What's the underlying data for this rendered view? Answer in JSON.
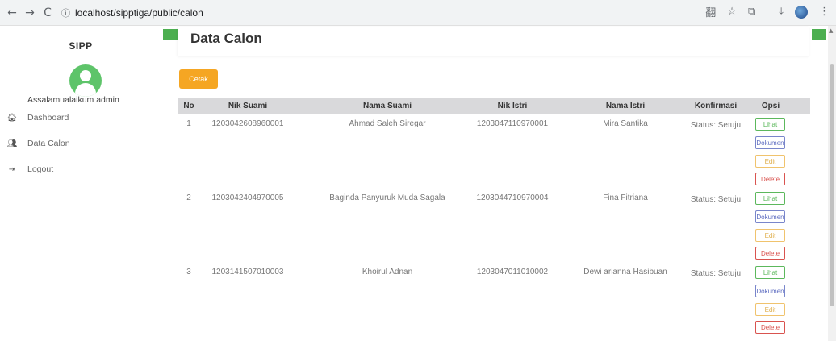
{
  "browser": {
    "url": "localhost/sipptiga/public/calon",
    "back_icon": "←",
    "forward_icon": "→",
    "reload_icon": "C",
    "info_icon": "ⓘ",
    "translate_icon": "翻",
    "star_icon": "☆",
    "extensions_icon": "⧉",
    "download_icon": "⤓",
    "menu_icon": "⋮"
  },
  "sidebar": {
    "brand": "SIPP",
    "greeting_prefix": "Assalamualaikum",
    "greeting_user": "admin",
    "items": [
      {
        "label": "Dashboard",
        "icon": "🏠︎"
      },
      {
        "label": "Data Calon",
        "icon": "👥︎"
      },
      {
        "label": "Logout",
        "icon": "⇥"
      }
    ]
  },
  "main": {
    "title": "Data Calon",
    "cetak_label": "Cetak"
  },
  "table": {
    "headers": [
      "No",
      "Nik Suami",
      "Nama Suami",
      "Nik Istri",
      "Nama Istri",
      "Konfirmasi",
      "Opsi"
    ],
    "rows": [
      {
        "no": "1",
        "nik_suami": "1203042608960001",
        "nama_suami": "Ahmad Saleh Siregar",
        "nik_istri": "1203047110970001",
        "nama_istri": "Mira Santika",
        "konfirmasi": "Status: Setuju"
      },
      {
        "no": "2",
        "nik_suami": "1203042404970005",
        "nama_suami": "Baginda Panyuruk Muda Sagala",
        "nik_istri": "1203044710970004",
        "nama_istri": "Fina Fitriana",
        "konfirmasi": "Status: Setuju"
      },
      {
        "no": "3",
        "nik_suami": "1203141507010003",
        "nama_suami": "Khoirul Adnan",
        "nik_istri": "1203047011010002",
        "nama_istri": "Dewi arianna Hasibuan",
        "konfirmasi": "Status: Setuju"
      }
    ],
    "actions": {
      "lihat": "Lihat",
      "dokumen": "Dokumen",
      "edit": "Edit",
      "delete": "Delete"
    }
  }
}
